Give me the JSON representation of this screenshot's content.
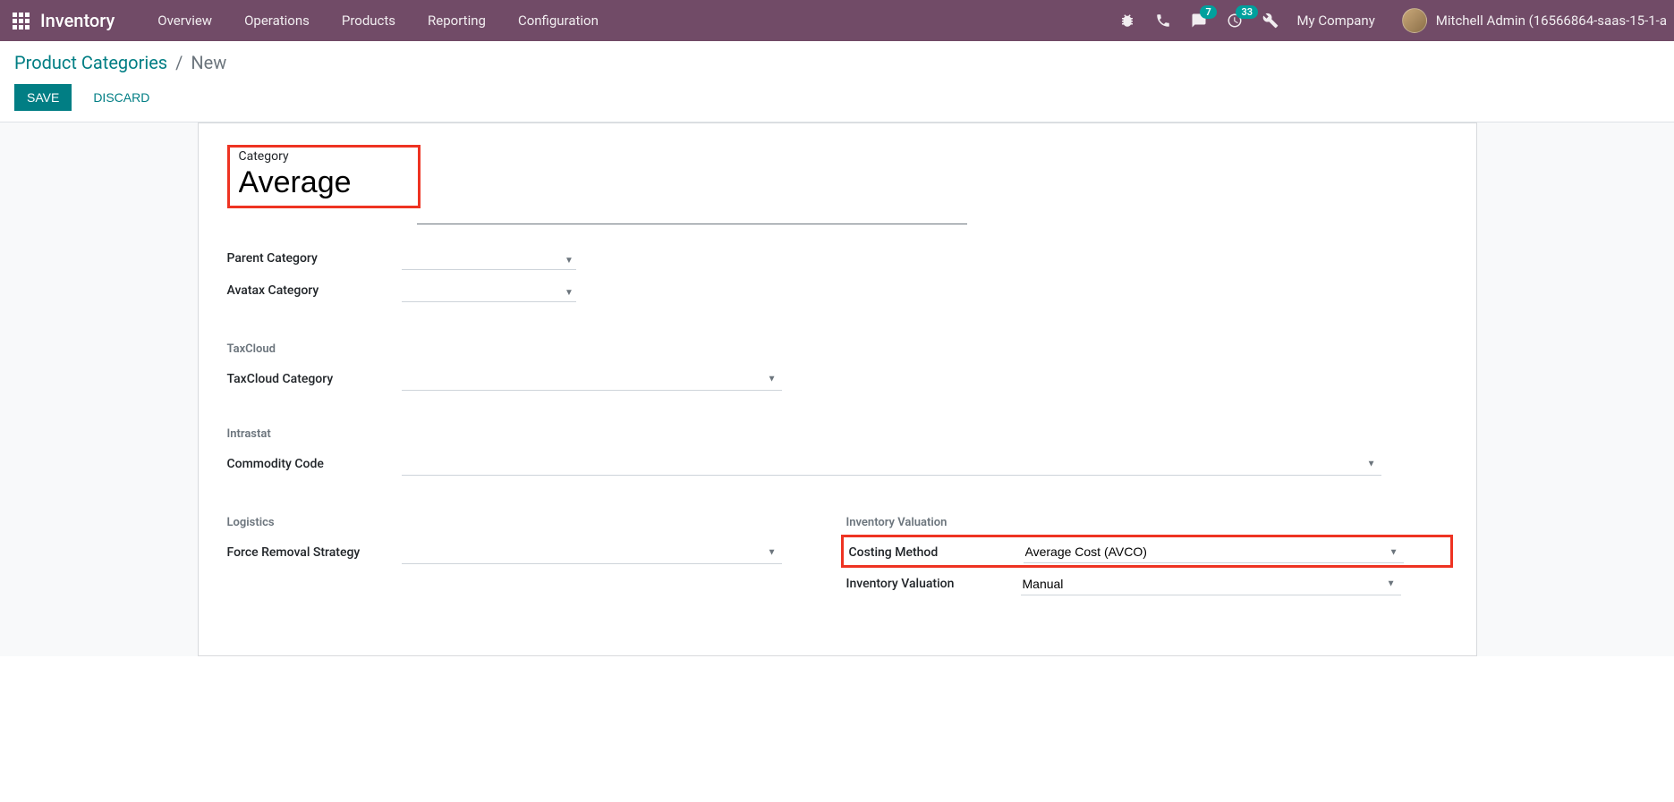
{
  "navbar": {
    "brand": "Inventory",
    "menu": [
      "Overview",
      "Operations",
      "Products",
      "Reporting",
      "Configuration"
    ],
    "chat_badge": "7",
    "activity_badge": "33",
    "company": "My Company",
    "user": "Mitchell Admin (16566864-saas-15-1-a"
  },
  "breadcrumb": {
    "parent": "Product Categories",
    "current": "New"
  },
  "buttons": {
    "save": "Save",
    "discard": "Discard"
  },
  "form": {
    "category_label": "Category",
    "category_value": "Average",
    "parent_category_label": "Parent Category",
    "parent_category_value": "",
    "avatax_category_label": "Avatax Category",
    "avatax_category_value": "",
    "taxcloud_section": "TaxCloud",
    "taxcloud_category_label": "TaxCloud Category",
    "taxcloud_category_value": "",
    "intrastat_section": "Intrastat",
    "commodity_code_label": "Commodity Code",
    "commodity_code_value": "",
    "logistics_section": "Logistics",
    "force_removal_label": "Force Removal Strategy",
    "force_removal_value": "",
    "inventory_valuation_section": "Inventory Valuation",
    "costing_method_label": "Costing Method",
    "costing_method_value": "Average Cost (AVCO)",
    "inventory_valuation_label": "Inventory Valuation",
    "inventory_valuation_value": "Manual"
  }
}
